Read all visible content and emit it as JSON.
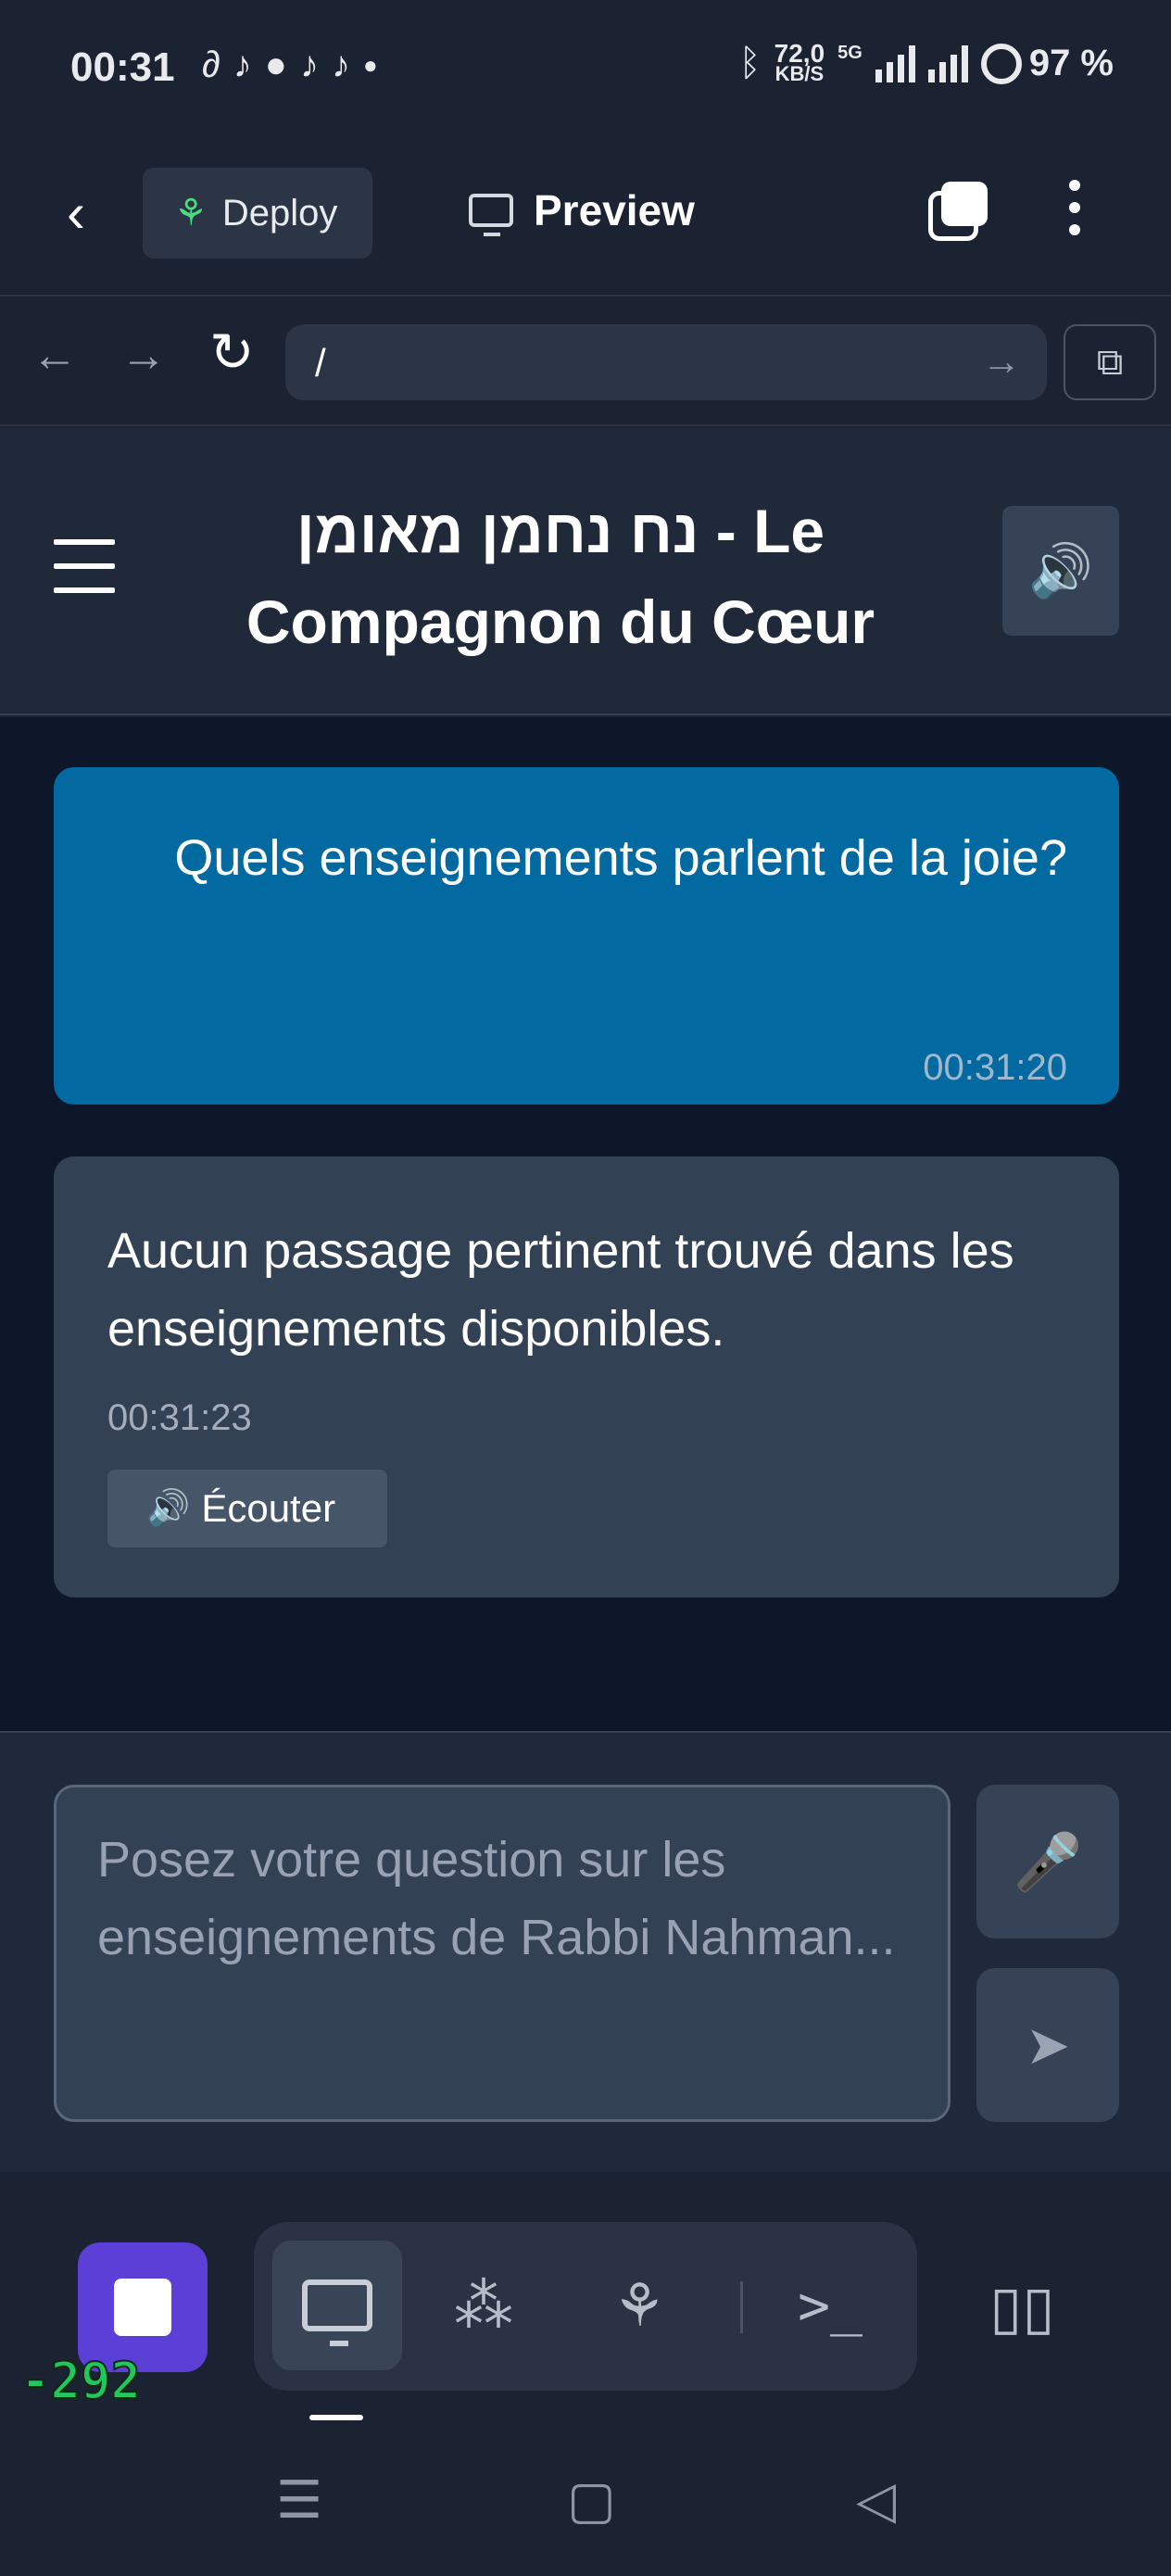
{
  "status_bar": {
    "time": "00:31",
    "net_speed_value": "72,0",
    "net_speed_unit": "KB/S",
    "network": "5G",
    "battery": "97 %"
  },
  "topbar": {
    "deploy_label": "Deploy",
    "preview_label": "Preview"
  },
  "urlbar": {
    "url": "/"
  },
  "page": {
    "title": "נח נחמן מאומן - Le Compagnon du Cœur"
  },
  "chat": {
    "messages": [
      {
        "role": "user",
        "text": "Quels enseignements parlent de la joie?",
        "time": "00:31:20"
      },
      {
        "role": "assistant",
        "text": "Aucun passage pertinent trouvé dans les enseignements disponibles.",
        "time": "00:31:23",
        "listen_label": "Écouter"
      }
    ]
  },
  "input": {
    "placeholder": "Posez votre question sur les enseignements de Rabbi Nahman..."
  },
  "toolbar": {
    "counter": "-292"
  },
  "colors": {
    "user_bubble": "#0369a1",
    "assistant_bubble": "#334155",
    "stop_button": "#5b3fd6",
    "counter_text": "#22c55e"
  }
}
